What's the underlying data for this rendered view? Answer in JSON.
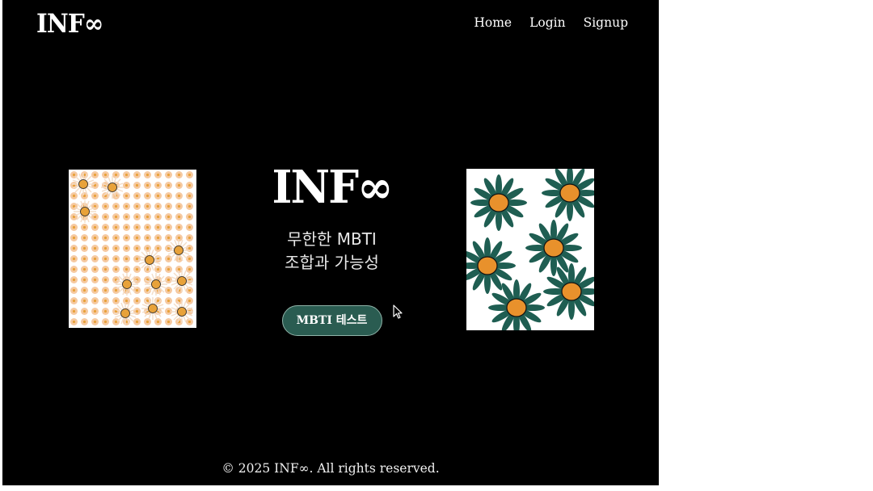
{
  "header": {
    "logo_text": "INF∞",
    "nav": [
      {
        "label": "Home"
      },
      {
        "label": "Login"
      },
      {
        "label": "Signup"
      }
    ]
  },
  "hero": {
    "logo_text": "INF∞",
    "tagline_line1": "무한한 MBTI",
    "tagline_line2": "조합과 가능성",
    "cta_label": "MBTI 테스트"
  },
  "footer": {
    "text": "© 2025 INF∞. All rights reserved."
  },
  "colors": {
    "background": "#000000",
    "cta": "#2a5c51",
    "daisy_petal": "#f6c9a0",
    "daisy_center": "#e8a23a",
    "leaf_green": "#1f5e52",
    "flower_orange": "#e8912c"
  },
  "icons": {
    "left_panel": "daisy-pattern-illustration",
    "right_panel": "green-petal-flower-illustration",
    "cursor": "mouse-cursor-icon"
  }
}
